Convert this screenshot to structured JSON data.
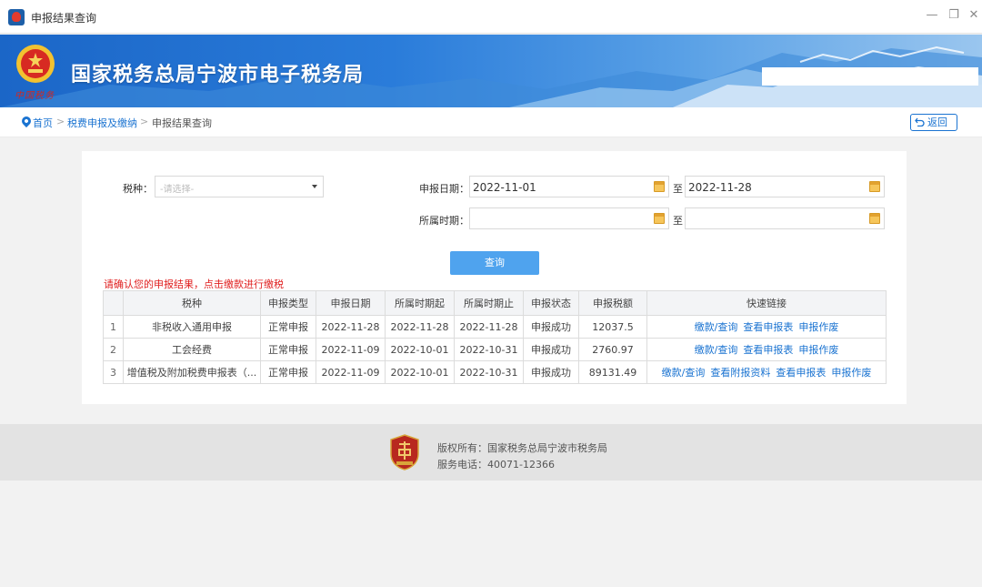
{
  "window": {
    "title": "申报结果查询",
    "min_icon": "minimize-icon",
    "restore_icon": "restore-icon",
    "close_icon": "close-icon"
  },
  "banner": {
    "bureau_name": "国家税务总局宁波市电子税务局",
    "emblem_caption": "中国税务"
  },
  "breadcrumb": {
    "home": "首页",
    "sep": ">",
    "level2": "税费申报及缴纳",
    "current": "申报结果查询",
    "back_label": "返回"
  },
  "form": {
    "tax_type_label": "税种：",
    "tax_type_placeholder": "-请选择-",
    "report_date_label": "申报日期：",
    "report_date_from": "2022-11-01",
    "to_label": "至",
    "report_date_to": "2022-11-28",
    "period_label": "所属时期：",
    "period_from": "",
    "period_to": "",
    "query_label": "查询"
  },
  "notice": "请确认您的申报结果，点击缴款进行缴税",
  "table": {
    "headers": [
      "",
      "税种",
      "申报类型",
      "申报日期",
      "所属时期起",
      "所属时期止",
      "申报状态",
      "申报税额",
      "快速链接"
    ],
    "rows": [
      {
        "idx": "1",
        "tax": "非税收入通用申报",
        "type": "正常申报",
        "date": "2022-11-28",
        "start": "2022-11-28",
        "end": "2022-11-28",
        "status": "申报成功",
        "amount": "12037.5",
        "links": [
          "缴款/查询",
          "查看申报表",
          "申报作废"
        ]
      },
      {
        "idx": "2",
        "tax": "工会经费",
        "type": "正常申报",
        "date": "2022-11-09",
        "start": "2022-10-01",
        "end": "2022-10-31",
        "status": "申报成功",
        "amount": "2760.97",
        "links": [
          "缴款/查询",
          "查看申报表",
          "申报作废"
        ]
      },
      {
        "idx": "3",
        "tax": "增值税及附加税费申报表（...",
        "type": "正常申报",
        "date": "2022-11-09",
        "start": "2022-10-01",
        "end": "2022-10-31",
        "status": "申报成功",
        "amount": "89131.49",
        "links": [
          "缴款/查询",
          "查看附报资料",
          "查看申报表",
          "申报作废"
        ]
      }
    ]
  },
  "footer": {
    "copyright": "版权所有：国家税务总局宁波市税务局",
    "service": "服务电话：40071-12366"
  },
  "colors": {
    "accent": "#1a73d1",
    "button": "#4fa3ee",
    "warning": "#e02020",
    "banner": "#2a7cda"
  }
}
